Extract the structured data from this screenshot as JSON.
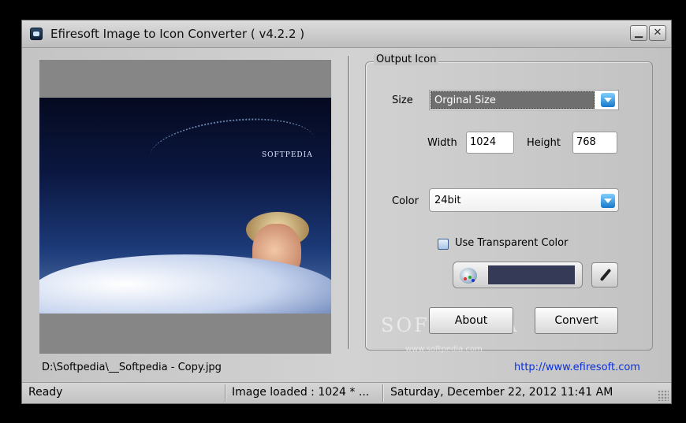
{
  "window": {
    "title": "Efiresoft Image to Icon Converter ( v4.2.2 )"
  },
  "titlebar": {
    "minimize_icon": "minimize-icon",
    "close_icon": "close-icon",
    "minimize_glyph": "▁",
    "close_glyph": "✕"
  },
  "preview": {
    "image_brand_text": "SOFTPEDIA"
  },
  "output": {
    "legend": "Output Icon",
    "size_label": "Size",
    "size_value": "Orginal Size",
    "width_label": "Width",
    "width_value": "1024",
    "height_label": "Height",
    "height_value": "768",
    "color_label": "Color",
    "color_value": "24bit",
    "transparent_label": "Use Transparent Color",
    "transparent_checked": false,
    "swatch_color": "#353b57",
    "about_label": "About",
    "convert_label": "Convert"
  },
  "file_path": "D:\\Softpedia\\__Softpedia - Copy.jpg",
  "website": "http://www.efiresoft.com",
  "watermark": {
    "text": "SOFTPEDIA",
    "sub": "www.softpedia.com"
  },
  "status": {
    "state": "Ready",
    "image_info": "Image loaded : 1024 * ...",
    "datetime": "Saturday, December 22, 2012 11:41 AM"
  }
}
